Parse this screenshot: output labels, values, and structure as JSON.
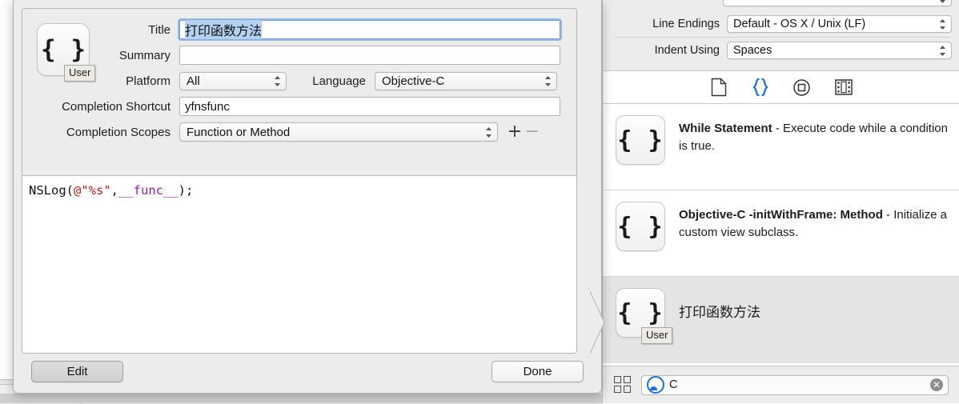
{
  "inspector": {
    "rows": [
      {
        "label": "Line Endings",
        "value": "Default - OS X / Unix (LF)"
      },
      {
        "label": "Indent Using",
        "value": "Spaces"
      }
    ]
  },
  "library_toolbar": {
    "icons": [
      {
        "name": "file-template-icon",
        "label": "File Template Library",
        "selected": false
      },
      {
        "name": "code-snippet-icon",
        "label": "Code Snippet Library",
        "selected": true
      },
      {
        "name": "object-icon",
        "label": "Object Library",
        "selected": false
      },
      {
        "name": "media-icon",
        "label": "Media Library",
        "selected": false
      }
    ],
    "accent": "#1a6fe0"
  },
  "library_list": {
    "rows": [
      {
        "icon_glyph": "{ }",
        "title": "While Statement",
        "separator": " - ",
        "description": "Execute code while a condition is true.",
        "badge": "",
        "selected": false
      },
      {
        "icon_glyph": "{ }",
        "title": "Objective-C -initWithFrame: Method",
        "separator": " - ",
        "description": "Initialize a custom view subclass.",
        "badge": "",
        "selected": false
      },
      {
        "icon_glyph": "{ }",
        "title": "打印函数方法",
        "separator": "",
        "description": "",
        "badge": "User",
        "selected": true
      }
    ]
  },
  "library_search": {
    "grid_icon": "grid-icon",
    "scope_icon": "scope-circle-icon",
    "value": "C",
    "placeholder": "",
    "clear_label": "✕"
  },
  "popover": {
    "snippet_icon_glyph": "{ }",
    "snippet_badge": "User",
    "fields": {
      "title_label": "Title",
      "title_value": "打印函数方法",
      "summary_label": "Summary",
      "summary_value": "",
      "platform_label": "Platform",
      "platform_value": "All",
      "language_label": "Language",
      "language_value": "Objective-C",
      "shortcut_label": "Completion Shortcut",
      "shortcut_value": "yfnsfunc",
      "scopes_label": "Completion Scopes",
      "scopes_value": "Function or Method",
      "add_scope_label": "+",
      "remove_scope_label": "−"
    },
    "code": {
      "part1": "NSLog(",
      "part2": "@\"%s\"",
      "part3": ",",
      "part4": "__func__",
      "part5": ");"
    },
    "buttons": {
      "edit_label": "Edit",
      "done_label": "Done"
    }
  }
}
